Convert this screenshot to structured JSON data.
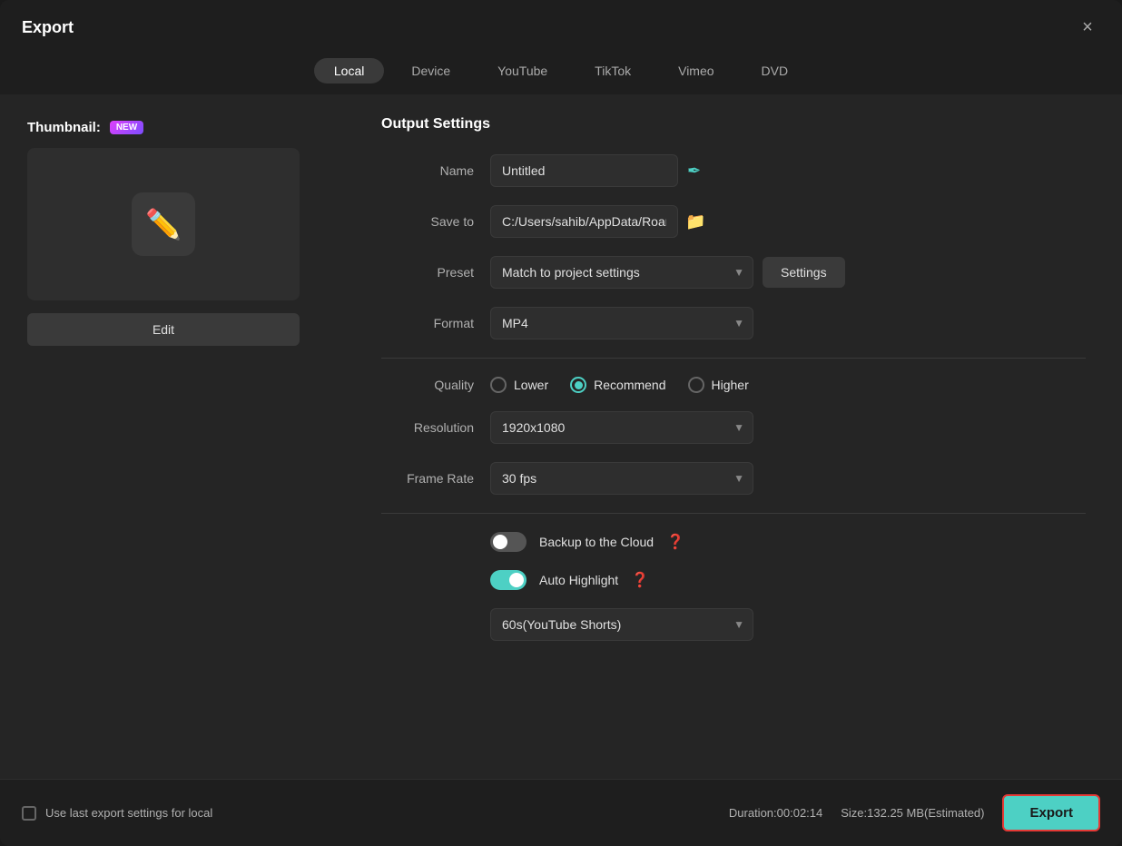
{
  "dialog": {
    "title": "Export",
    "close_label": "×"
  },
  "tabs": [
    {
      "id": "local",
      "label": "Local",
      "active": true
    },
    {
      "id": "device",
      "label": "Device",
      "active": false
    },
    {
      "id": "youtube",
      "label": "YouTube",
      "active": false
    },
    {
      "id": "tiktok",
      "label": "TikTok",
      "active": false
    },
    {
      "id": "vimeo",
      "label": "Vimeo",
      "active": false
    },
    {
      "id": "dvd",
      "label": "DVD",
      "active": false
    }
  ],
  "left": {
    "thumbnail_label": "Thumbnail:",
    "new_badge": "NEW",
    "edit_label": "Edit"
  },
  "output": {
    "section_title": "Output Settings",
    "name_label": "Name",
    "name_value": "Untitled",
    "save_to_label": "Save to",
    "save_to_value": "C:/Users/sahib/AppData/Roan",
    "preset_label": "Preset",
    "preset_value": "Match to project settings",
    "settings_label": "Settings",
    "format_label": "Format",
    "format_value": "MP4",
    "quality_label": "Quality",
    "quality_options": [
      {
        "id": "lower",
        "label": "Lower",
        "checked": false
      },
      {
        "id": "recommend",
        "label": "Recommend",
        "checked": true
      },
      {
        "id": "higher",
        "label": "Higher",
        "checked": false
      }
    ],
    "resolution_label": "Resolution",
    "resolution_value": "1920x1080",
    "frame_rate_label": "Frame Rate",
    "frame_rate_value": "30 fps",
    "backup_label": "Backup to the Cloud",
    "backup_enabled": false,
    "auto_highlight_label": "Auto Highlight",
    "auto_highlight_enabled": true,
    "highlight_duration_value": "60s(YouTube Shorts)"
  },
  "footer": {
    "checkbox_label": "Use last export settings for local",
    "duration_label": "Duration:00:02:14",
    "size_label": "Size:132.25 MB(Estimated)",
    "export_label": "Export"
  }
}
